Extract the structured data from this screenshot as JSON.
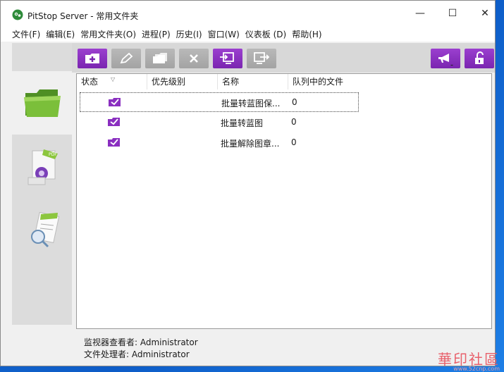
{
  "window": {
    "title": "PitStop Server  -  常用文件夹",
    "controls": {
      "minimize": "—",
      "maximize": "☐",
      "close": "✕"
    }
  },
  "menu": [
    "文件(F)",
    "编辑(E)",
    "常用文件夹(O)",
    "进程(P)",
    "历史(I)",
    "窗口(W)",
    "仪表板 (D)",
    "帮助(H)"
  ],
  "sidebar": {
    "tabs": [
      {
        "name": "favorites-folder-icon",
        "active": true
      },
      {
        "name": "pdf-process-icon",
        "active": false
      },
      {
        "name": "report-search-icon",
        "active": false
      }
    ]
  },
  "toolbar": {
    "buttons": [
      "add-folder-icon",
      "edit-pencil-icon",
      "duplicate-folder-icon",
      "delete-x-icon",
      "import-icon",
      "export-icon"
    ],
    "right_buttons": [
      "megaphone-icon",
      "unlock-icon"
    ]
  },
  "table": {
    "columns": [
      "状态",
      "优先级别",
      "名称",
      "队列中的文件"
    ],
    "rows": [
      {
        "name": "批量转蓝图保...",
        "queued": "0",
        "selected": true
      },
      {
        "name": "批量转蓝图",
        "queued": "0",
        "selected": false
      },
      {
        "name": "批量解除图章...",
        "queued": "0",
        "selected": false
      }
    ]
  },
  "footer": {
    "monitor_viewer": "监视器查看者: Administrator",
    "file_processor": "文件处理者: Administrator"
  },
  "watermark": {
    "text": "華印社區",
    "url": "www.52cnp.com"
  },
  "colors": {
    "accent_purple": "#8a2fc0",
    "folder_green": "#5a9e2e",
    "desktop_blue": "#1b6fd1"
  }
}
